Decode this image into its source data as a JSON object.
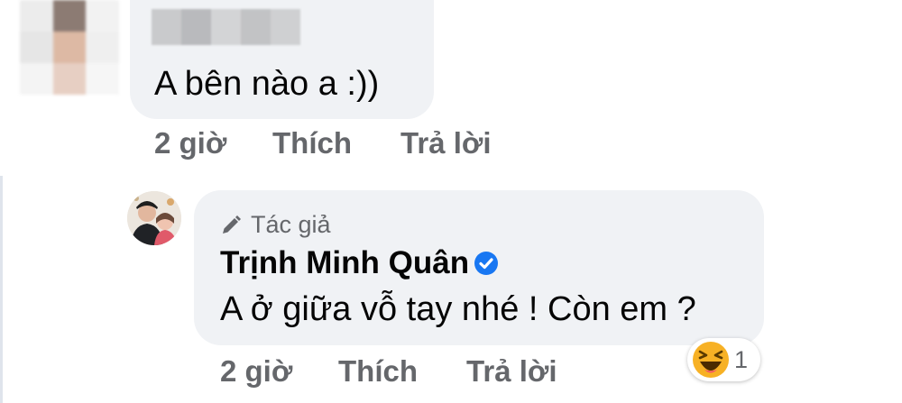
{
  "colors": {
    "bubble": "#f0f2f5",
    "text": "#050505",
    "secondary_text": "#65676b",
    "verified_blue": "#1877f2",
    "haha_yellow": "#f7b125"
  },
  "first_comment": {
    "author_avatar": "blurred-avatar",
    "author_name": "blurred-name",
    "text": "A bên nào a :))",
    "actions": {
      "time": "2 giờ",
      "like": "Thích",
      "reply": "Trả lời"
    }
  },
  "reply_comment": {
    "author_badge_icon": "pencil-icon",
    "author_badge": "Tác giả",
    "author_name": "Trịnh Minh Quân",
    "verified_icon": "verified-check-icon",
    "text": "A ở giữa vỗ tay nhé ! Còn em ?",
    "reaction": {
      "icon": "haha-reaction-icon",
      "count": "1"
    },
    "actions": {
      "time": "2 giờ",
      "like": "Thích",
      "reply": "Trả lời"
    }
  }
}
